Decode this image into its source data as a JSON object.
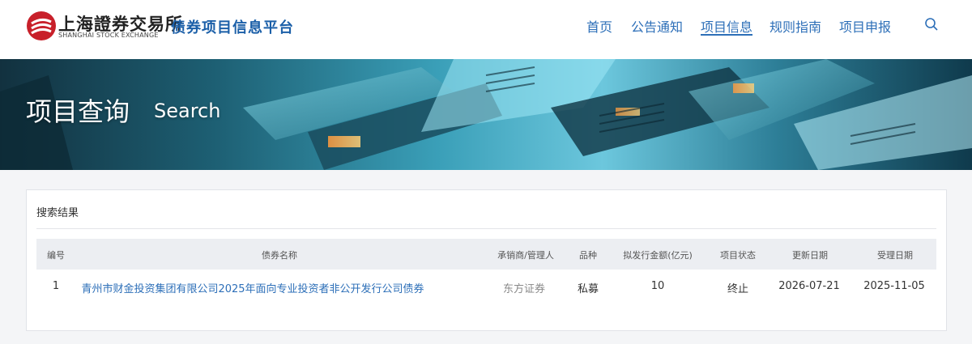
{
  "header": {
    "logo_cn": "上海證券交易所",
    "logo_en": "SHANGHAI STOCK EXCHANGE",
    "platform_title": "债券项目信息平台",
    "nav": [
      {
        "label": "首页"
      },
      {
        "label": "公告通知"
      },
      {
        "label": "项目信息",
        "active": true
      },
      {
        "label": "规则指南"
      },
      {
        "label": "项目申报"
      }
    ],
    "search_icon": "search-icon",
    "brand_color": "#c8202a",
    "accent_color": "#2d6fb8"
  },
  "banner": {
    "title": "项目查询",
    "subtitle": "Search"
  },
  "results": {
    "title": "搜索结果",
    "columns": [
      "编号",
      "债券名称",
      "承销商/管理人",
      "品种",
      "拟发行金额(亿元)",
      "项目状态",
      "更新日期",
      "受理日期"
    ],
    "rows": [
      {
        "index": "1",
        "bond_name": "青州市财金投资集团有限公司2025年面向专业投资者非公开发行公司债券",
        "underwriter": "东方证券",
        "type": "私募",
        "amount": "10",
        "status": "终止",
        "updated": "2026-07-21",
        "accepted": "2025-11-05"
      }
    ]
  }
}
